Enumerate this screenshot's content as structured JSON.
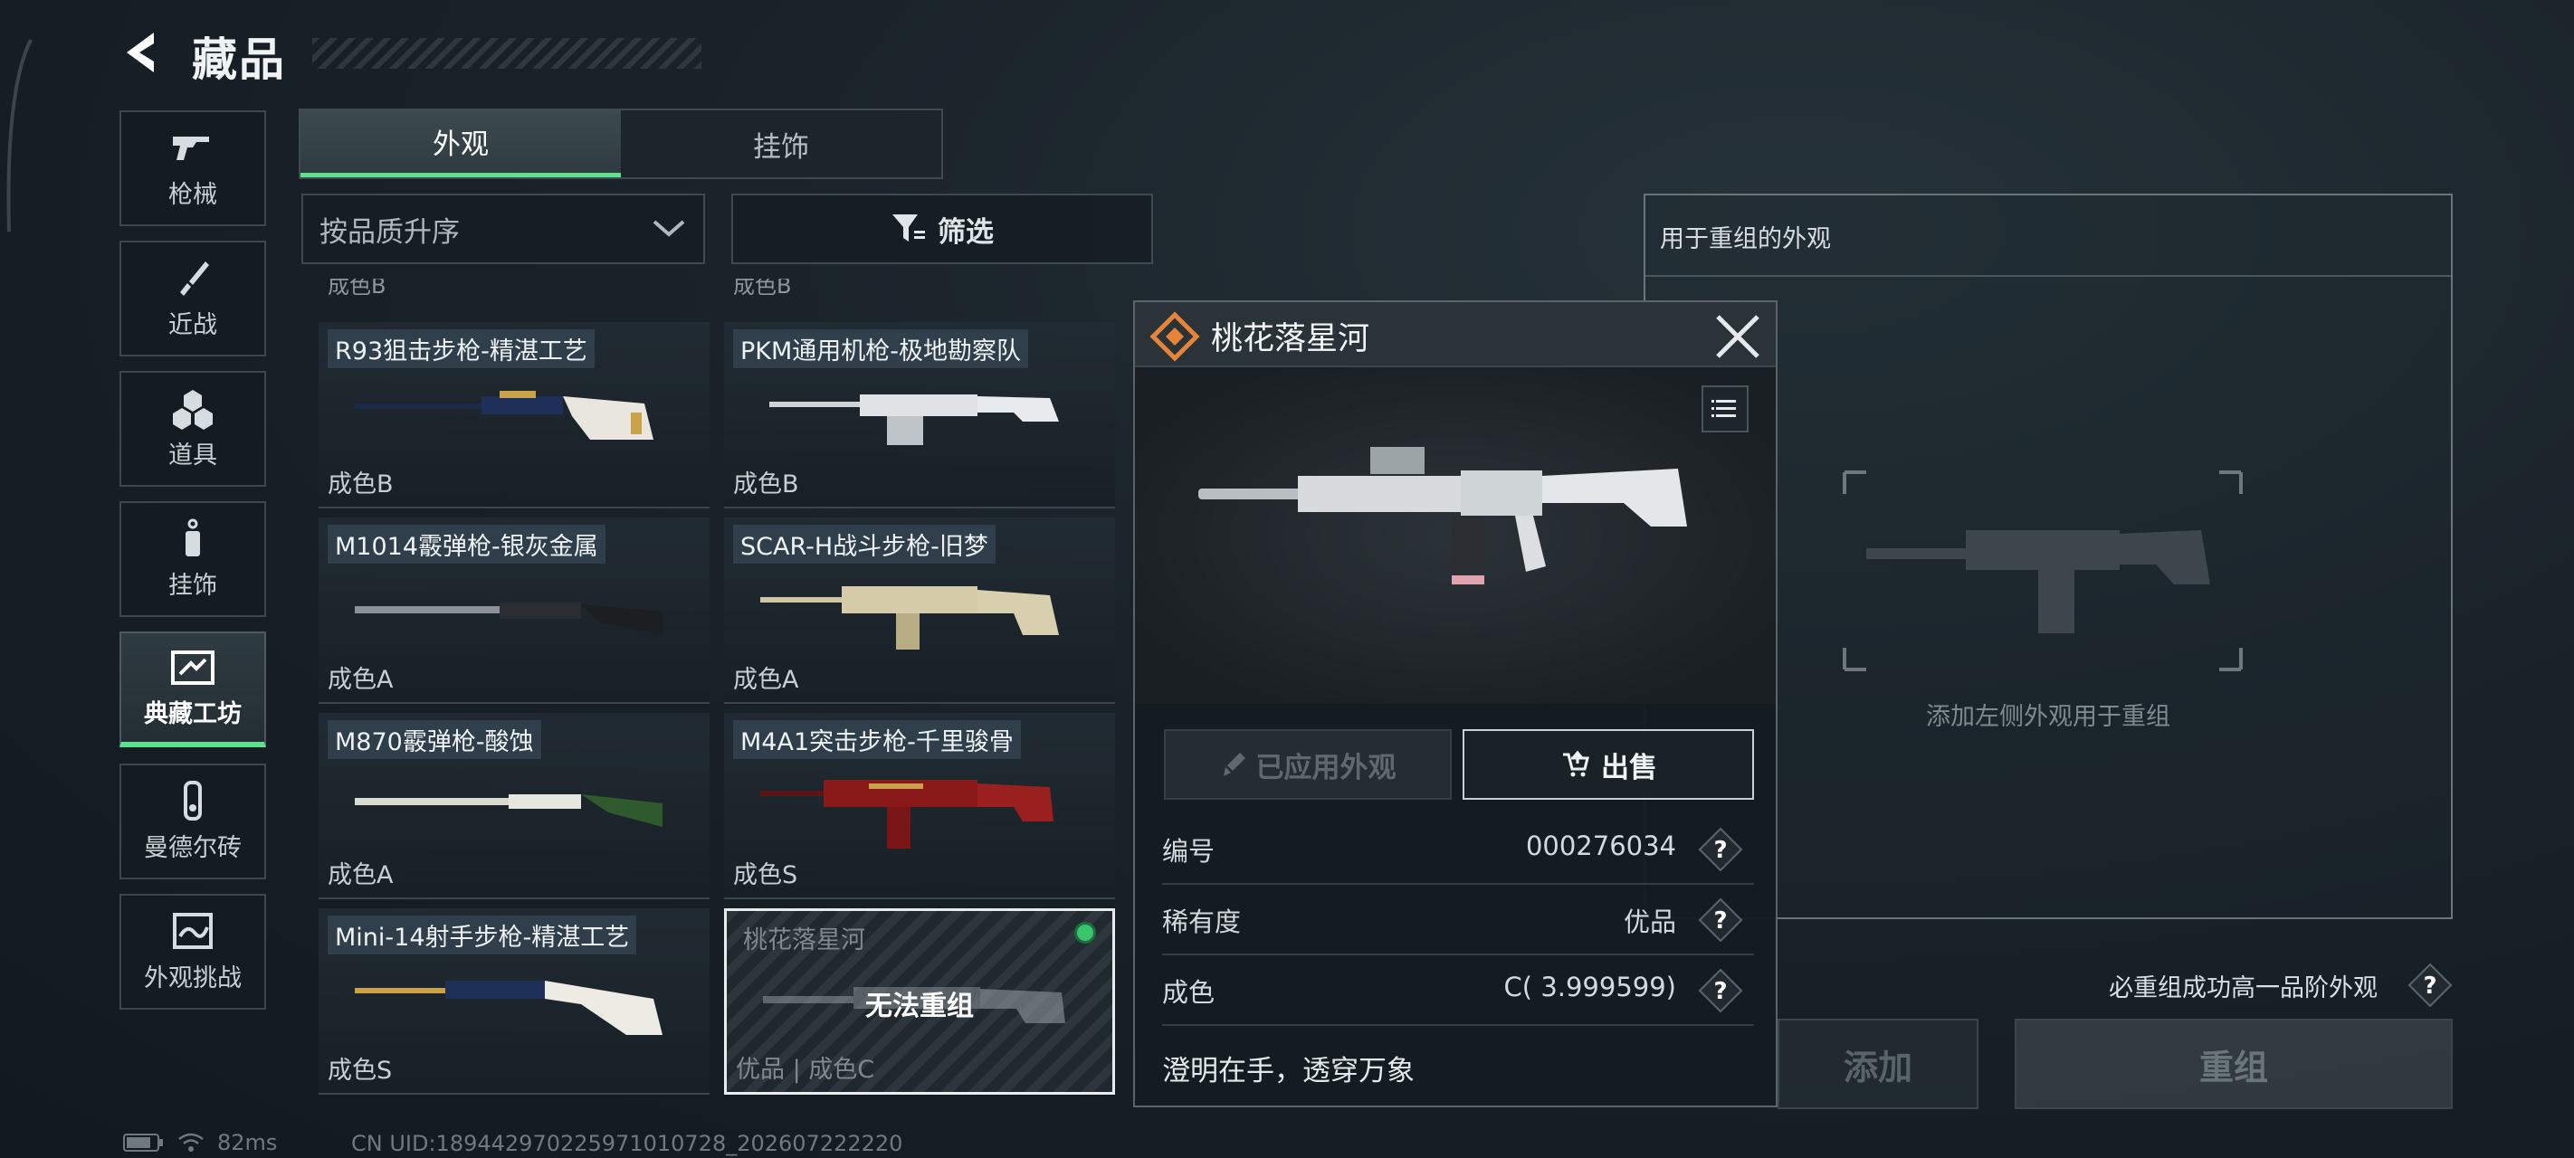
{
  "header": {
    "title": "藏品"
  },
  "nav": [
    {
      "label": "枪械",
      "icon": "gun-icon",
      "active": false
    },
    {
      "label": "近战",
      "icon": "knife-icon",
      "active": false
    },
    {
      "label": "道具",
      "icon": "grenade-icon",
      "active": false
    },
    {
      "label": "挂饰",
      "icon": "charm-icon",
      "active": false
    },
    {
      "label": "典藏工坊",
      "icon": "workshop-icon",
      "active": true
    },
    {
      "label": "曼德尔砖",
      "icon": "brick-icon",
      "active": false
    },
    {
      "label": "外观挑战",
      "icon": "challenge-icon",
      "active": false
    }
  ],
  "tabs": [
    {
      "label": "外观",
      "active": true
    },
    {
      "label": "挂饰",
      "active": false
    }
  ],
  "sort": {
    "value": "按品质升序"
  },
  "filter": {
    "label": "筛选"
  },
  "grid": {
    "partial_top": [
      "成色B",
      "成色B"
    ],
    "items": [
      {
        "name": "R93狙击步枪-精湛工艺",
        "condition": "成色B"
      },
      {
        "name": "PKM通用机枪-极地勘察队",
        "condition": "成色B"
      },
      {
        "name": "M1014霰弹枪-银灰金属",
        "condition": "成色A"
      },
      {
        "name": "SCAR-H战斗步枪-旧梦",
        "condition": "成色A"
      },
      {
        "name": "M870霰弹枪-酸蚀",
        "condition": "成色A"
      },
      {
        "name": "M4A1突击步枪-千里骏骨",
        "condition": "成色S"
      },
      {
        "name": "Mini-14射手步枪-精湛工艺",
        "condition": "成色S"
      },
      {
        "name": "桃花落星河",
        "condition": "优品 | 成色C",
        "overlay": "无法重组",
        "selected": true
      }
    ]
  },
  "detail": {
    "title": "桃花落星河",
    "applied_label": "已应用外观",
    "sell_label": "出售",
    "rows": [
      {
        "key": "编号",
        "value": "000276034"
      },
      {
        "key": "稀有度",
        "value": "优品"
      },
      {
        "key": "成色",
        "value": "C( 3.999599)"
      }
    ],
    "description": "澄明在手，透穿万象"
  },
  "recombine": {
    "title": "用于重组的外观",
    "hint": "添加左侧外观用于重组",
    "guarantee": "必重组成功高一品阶外观",
    "add_label": "添加",
    "recombine_label": "重组"
  },
  "status": {
    "ping": "82ms",
    "uid": "CN UID:18944297022597101072​8_202607222220"
  },
  "colors": {
    "accent": "#5fe08f",
    "rarity": "#e8843a"
  }
}
